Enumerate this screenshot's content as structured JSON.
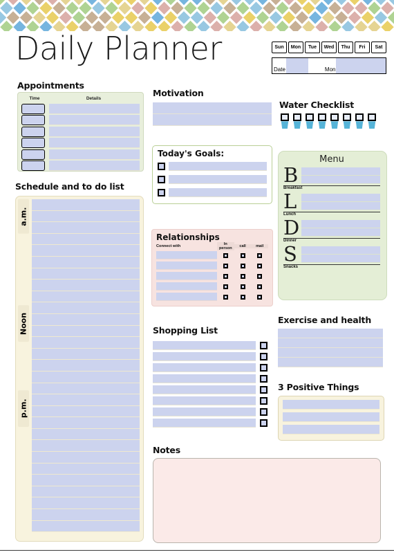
{
  "document": {
    "title": "Daily Planner"
  },
  "banner": {
    "icon": "diamond-pattern",
    "colors": [
      "#6aafdc",
      "#e8cd5c",
      "#a8cf8a",
      "#d9a9a4",
      "#c2a98c",
      "#8fc3e0",
      "#e3d08a"
    ]
  },
  "dayselector": {
    "days": [
      "Sun",
      "Mon",
      "Tue",
      "Wed",
      "Thu",
      "Fri",
      "Sat"
    ]
  },
  "daterow": {
    "date_label": "Date",
    "date_value": "",
    "month_label": "Mon",
    "month_value": ""
  },
  "appointments": {
    "heading": "Appointments",
    "columns": [
      "Time",
      "Details"
    ],
    "rows": [
      {
        "time": "",
        "details": ""
      },
      {
        "time": "",
        "details": ""
      },
      {
        "time": "",
        "details": ""
      },
      {
        "time": "",
        "details": ""
      },
      {
        "time": "",
        "details": ""
      },
      {
        "time": "",
        "details": ""
      }
    ]
  },
  "schedule": {
    "heading": "Schedule and to do list",
    "markers": [
      "a.m.",
      "Noon",
      "p.m."
    ],
    "row_count": 29,
    "rows": []
  },
  "motivation": {
    "heading": "Motivation",
    "lines": [
      "",
      ""
    ]
  },
  "goals": {
    "heading": "Today's Goals:",
    "items": [
      {
        "checked": false,
        "text": ""
      },
      {
        "checked": false,
        "text": ""
      },
      {
        "checked": false,
        "text": ""
      }
    ]
  },
  "relationships": {
    "heading": "Relationships",
    "name_column": "Connect with",
    "check_columns": [
      "In person",
      "call",
      "mail"
    ],
    "rows": [
      {
        "name": "",
        "in_person": false,
        "call": false,
        "mail": false
      },
      {
        "name": "",
        "in_person": false,
        "call": false,
        "mail": false
      },
      {
        "name": "",
        "in_person": false,
        "call": false,
        "mail": false
      },
      {
        "name": "",
        "in_person": false,
        "call": false,
        "mail": false
      },
      {
        "name": "",
        "in_person": false,
        "call": false,
        "mail": false
      }
    ]
  },
  "shopping": {
    "heading": "Shopping List",
    "items": [
      {
        "text": "",
        "checked": false
      },
      {
        "text": "",
        "checked": false
      },
      {
        "text": "",
        "checked": false
      },
      {
        "text": "",
        "checked": false
      },
      {
        "text": "",
        "checked": false
      },
      {
        "text": "",
        "checked": false
      },
      {
        "text": "",
        "checked": false
      },
      {
        "text": "",
        "checked": false
      }
    ]
  },
  "notes": {
    "heading": "Notes",
    "content": ""
  },
  "water": {
    "heading": "Water Checklist",
    "icon": "water-glass-icon",
    "glass_count": 8,
    "glasses": [
      {
        "checked": false
      },
      {
        "checked": false
      },
      {
        "checked": false
      },
      {
        "checked": false
      },
      {
        "checked": false
      },
      {
        "checked": false
      },
      {
        "checked": false
      },
      {
        "checked": false
      }
    ]
  },
  "menu": {
    "heading": "Menu",
    "blocks": [
      {
        "letter": "B",
        "label": "Breakfast",
        "lines": [
          "",
          ""
        ]
      },
      {
        "letter": "L",
        "label": "Lunch",
        "lines": [
          "",
          ""
        ]
      },
      {
        "letter": "D",
        "label": "Dinner",
        "lines": [
          "",
          ""
        ]
      },
      {
        "letter": "S",
        "label": "Snacks",
        "lines": [
          "",
          ""
        ]
      }
    ]
  },
  "exercise": {
    "heading": "Exercise and health",
    "lines": [
      "",
      "",
      "",
      ""
    ]
  },
  "positive": {
    "heading": "3 Positive Things",
    "lines": [
      "",
      "",
      ""
    ]
  },
  "colors": {
    "field_blue": "#ccd3ee",
    "green_panel": "#e4eed6",
    "pink_panel": "#f7e3e0",
    "cream_panel": "#f8f3de",
    "notes_pink": "#fbeae8",
    "water_blue": "#56b4d8"
  }
}
